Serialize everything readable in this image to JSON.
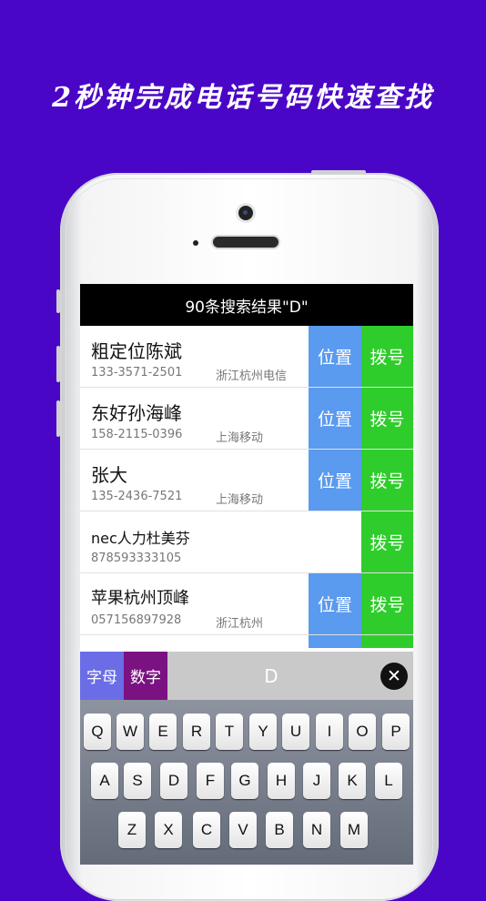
{
  "headline": "2秒钟完成电话号码快速查找",
  "navbar": {
    "title": "90条搜索结果\"D\""
  },
  "contacts": [
    {
      "name": "粗定位陈斌",
      "phone": "133-3571-2501",
      "location": "浙江杭州电信",
      "position_label": "位置",
      "dial_label": "拨号"
    },
    {
      "name": "东好孙海峰",
      "phone": "158-2115-0396",
      "location": "上海移动",
      "position_label": "位置",
      "dial_label": "拨号"
    },
    {
      "name": "张大",
      "phone": "135-2436-7521",
      "location": "上海移动",
      "position_label": "位置",
      "dial_label": "拨号"
    },
    {
      "name": "nec人力杜美芬",
      "phone": "878593333105",
      "location": "",
      "position_label": "",
      "dial_label": "拨号"
    },
    {
      "name": "苹果杭州顶峰",
      "phone": "057156897928",
      "location": "浙江杭州",
      "position_label": "位置",
      "dial_label": "拨号"
    }
  ],
  "input_bar": {
    "letters_label": "字母",
    "numbers_label": "数字",
    "query": "D",
    "clear_glyph": "✕"
  },
  "keyboard": {
    "row1": [
      "Q",
      "W",
      "E",
      "R",
      "T",
      "Y",
      "U",
      "I",
      "O",
      "P"
    ],
    "row2": [
      "A",
      "S",
      "D",
      "F",
      "G",
      "H",
      "J",
      "K",
      "L"
    ],
    "row3": [
      "Z",
      "X",
      "C",
      "V",
      "B",
      "N",
      "M"
    ]
  },
  "colors": {
    "background": "#4a06c6",
    "position_button": "#5a9aef",
    "dial_button": "#2fcd2b",
    "letters_tab": "#6a6de6",
    "numbers_tab": "#7a1282"
  }
}
